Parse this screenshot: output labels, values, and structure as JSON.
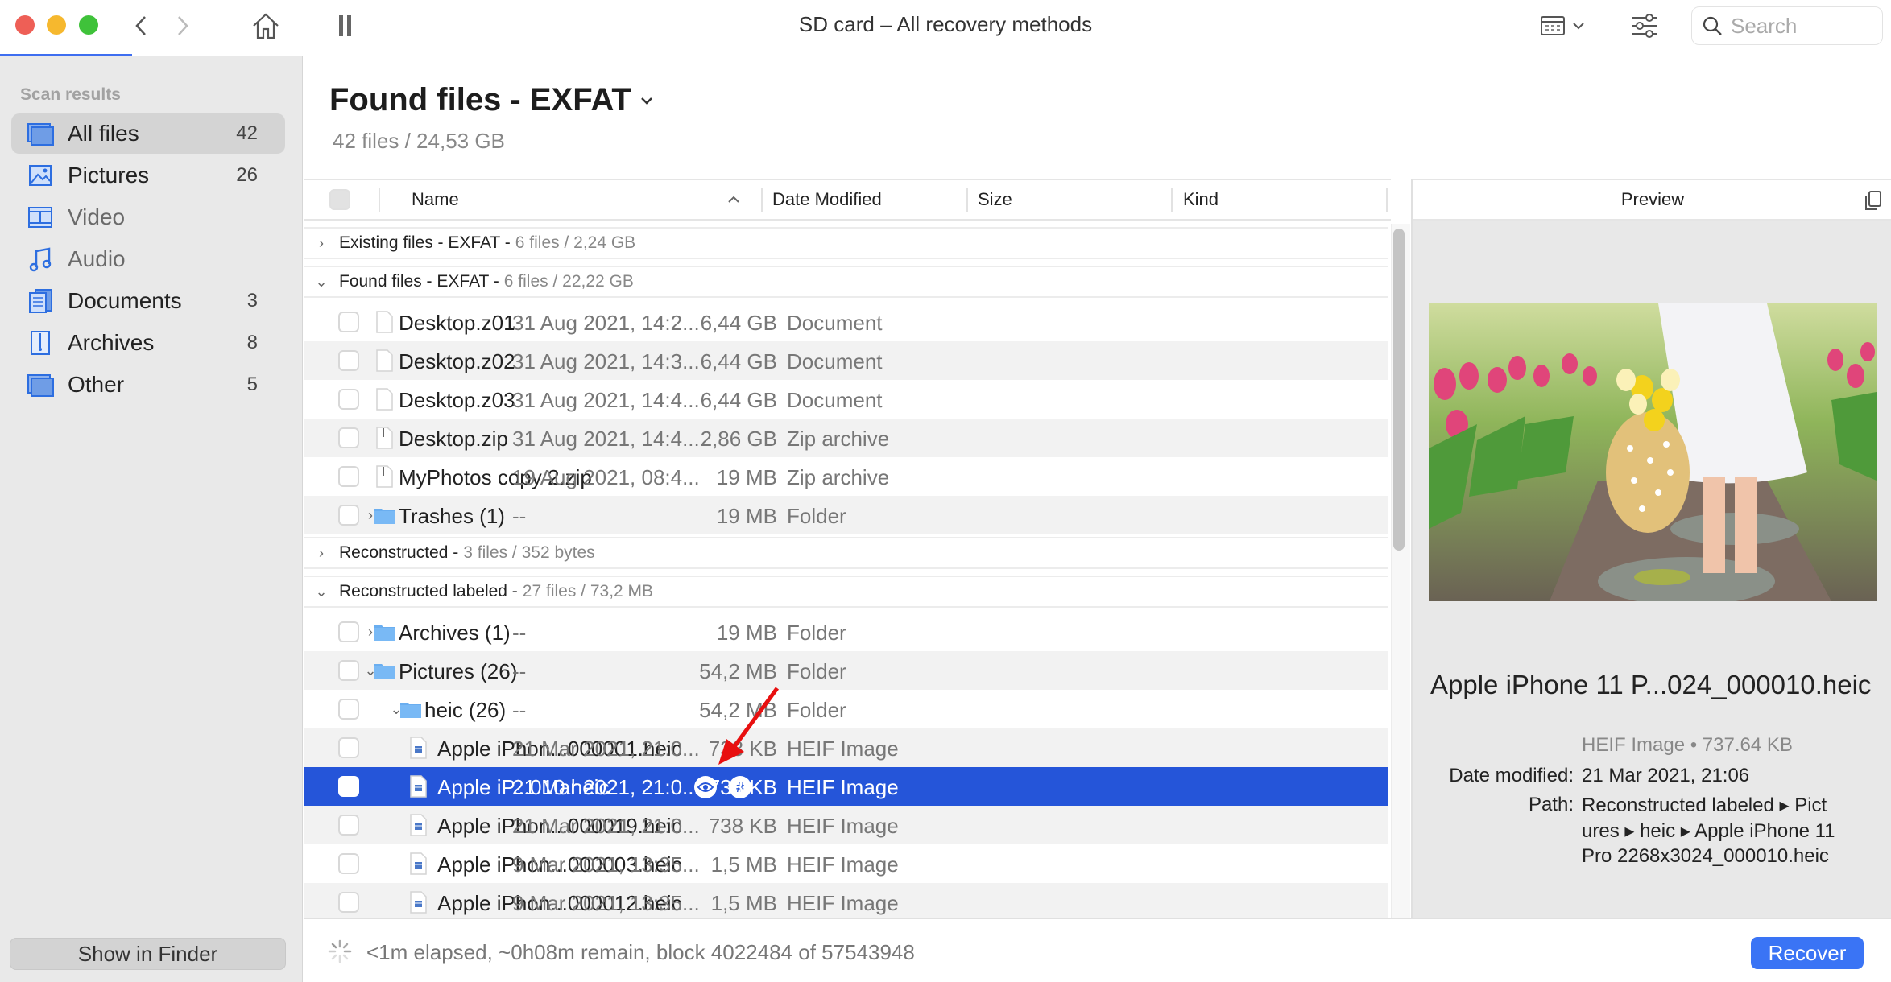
{
  "window": {
    "title": "SD card – All recovery methods",
    "scan_progress_fraction": 0.07
  },
  "toolbar": {
    "back_icon": "chevron-left-icon",
    "forward_icon": "chevron-right-icon",
    "home_icon": "home-icon",
    "pause_icon": "pause-icon",
    "view_icon": "grid-view-icon",
    "filter_icon": "sliders-icon",
    "search_placeholder": "Search",
    "search_value": ""
  },
  "sidebar": {
    "heading": "Scan results",
    "items": [
      {
        "label": "All files",
        "count": "42",
        "icon": "all-files-icon",
        "active": true,
        "dim": false
      },
      {
        "label": "Pictures",
        "count": "26",
        "icon": "pictures-icon",
        "active": false,
        "dim": false
      },
      {
        "label": "Video",
        "count": "",
        "icon": "video-icon",
        "active": false,
        "dim": true
      },
      {
        "label": "Audio",
        "count": "",
        "icon": "audio-icon",
        "active": false,
        "dim": true
      },
      {
        "label": "Documents",
        "count": "3",
        "icon": "documents-icon",
        "active": false,
        "dim": false
      },
      {
        "label": "Archives",
        "count": "8",
        "icon": "archives-icon",
        "active": false,
        "dim": false
      },
      {
        "label": "Other",
        "count": "5",
        "icon": "other-icon",
        "active": false,
        "dim": false
      }
    ],
    "show_in_finder": "Show in Finder"
  },
  "main": {
    "title": "Found files - EXFAT",
    "subtitle": "42 files / 24,53 GB"
  },
  "table": {
    "columns": {
      "name": "Name",
      "date": "Date Modified",
      "size": "Size",
      "kind": "Kind"
    },
    "groups": [
      {
        "name": "Existing files - EXFAT -",
        "stats": "6 files / 2,24 GB",
        "expanded": false
      },
      {
        "name": "Found files - EXFAT -",
        "stats": "6 files / 22,22 GB",
        "expanded": true
      },
      {
        "name": "Reconstructed -",
        "stats": "3 files / 352 bytes",
        "expanded": false
      },
      {
        "name": "Reconstructed labeled -",
        "stats": "27 files / 73,2 MB",
        "expanded": true
      }
    ],
    "rows": [
      {
        "name": "Desktop.z01",
        "date": "31 Aug 2021, 14:2...",
        "size": "6,44 GB",
        "kind": "Document",
        "type": "doc",
        "indent": 0,
        "twisty": ""
      },
      {
        "name": "Desktop.z02",
        "date": "31 Aug 2021, 14:3...",
        "size": "6,44 GB",
        "kind": "Document",
        "type": "doc",
        "indent": 0,
        "twisty": ""
      },
      {
        "name": "Desktop.z03",
        "date": "31 Aug 2021, 14:4...",
        "size": "6,44 GB",
        "kind": "Document",
        "type": "doc",
        "indent": 0,
        "twisty": ""
      },
      {
        "name": "Desktop.zip",
        "date": "31 Aug 2021, 14:4...",
        "size": "2,86 GB",
        "kind": "Zip archive",
        "type": "zip",
        "indent": 0,
        "twisty": ""
      },
      {
        "name": "MyPhotos copy 2.zip",
        "date": "19 Aug 2021, 08:4...",
        "size": "19 MB",
        "kind": "Zip archive",
        "type": "zip",
        "indent": 0,
        "twisty": ""
      },
      {
        "name": "Trashes (1)",
        "date": "--",
        "size": "19 MB",
        "kind": "Folder",
        "type": "folder",
        "indent": 0,
        "twisty": "closed"
      },
      {
        "name": "Archives (1)",
        "date": "--",
        "size": "19 MB",
        "kind": "Folder",
        "type": "folder",
        "indent": 0,
        "twisty": "closed"
      },
      {
        "name": "Pictures (26)",
        "date": "--",
        "size": "54,2 MB",
        "kind": "Folder",
        "type": "folder",
        "indent": 0,
        "twisty": "open"
      },
      {
        "name": "heic (26)",
        "date": "--",
        "size": "54,2 MB",
        "kind": "Folder",
        "type": "folder",
        "indent": 1,
        "twisty": "open"
      },
      {
        "name": "Apple iPhon...000001.heic",
        "date": "21 Mar 2021, 21:0...",
        "size": "738 KB",
        "kind": "HEIF Image",
        "type": "heic",
        "indent": 2,
        "twisty": ""
      },
      {
        "name": "Apple iP...010.heic",
        "date": "21 Mar 2021, 21:0...",
        "size": "738 KB",
        "kind": "HEIF Image",
        "type": "heic",
        "indent": 2,
        "twisty": "",
        "selected": true
      },
      {
        "name": "Apple iPhon...000019.heic",
        "date": "21 Mar 2021, 21:0...",
        "size": "738 KB",
        "kind": "HEIF Image",
        "type": "heic",
        "indent": 2,
        "twisty": ""
      },
      {
        "name": "Apple iPhon...000003.heic",
        "date": "9 Mar 2021, 13:35...",
        "size": "1,5 MB",
        "kind": "HEIF Image",
        "type": "heic",
        "indent": 2,
        "twisty": ""
      },
      {
        "name": "Apple iPhon...000012.heic",
        "date": "9 Mar 2021, 13:35...",
        "size": "1,5 MB",
        "kind": "HEIF Image",
        "type": "heic",
        "indent": 2,
        "twisty": ""
      }
    ],
    "selected_row_actions": [
      "eye-icon",
      "hash-icon"
    ]
  },
  "preview": {
    "header": "Preview",
    "file_name": "Apple iPhone 11 P...024_000010.heic",
    "kind_size": "HEIF Image • 737.64 KB",
    "date_label": "Date modified:",
    "date_value": "21 Mar 2021, 21:06",
    "path_label": "Path:",
    "path_lines": [
      "Reconstructed labeled ▸ Pict",
      "ures ▸ heic ▸ Apple iPhone 11",
      "Pro 2268x3024_000010.heic"
    ],
    "image_description": "woman in white dress holding basket of yellow tulips on garden path with pink tulips"
  },
  "footer": {
    "status": "<1m elapsed, ~0h08m remain, block 4022484 of 57543948",
    "recover_label": "Recover"
  },
  "colors": {
    "accent": "#3a74f5",
    "selection": "#2555d9",
    "annotation_arrow": "#e81010"
  }
}
